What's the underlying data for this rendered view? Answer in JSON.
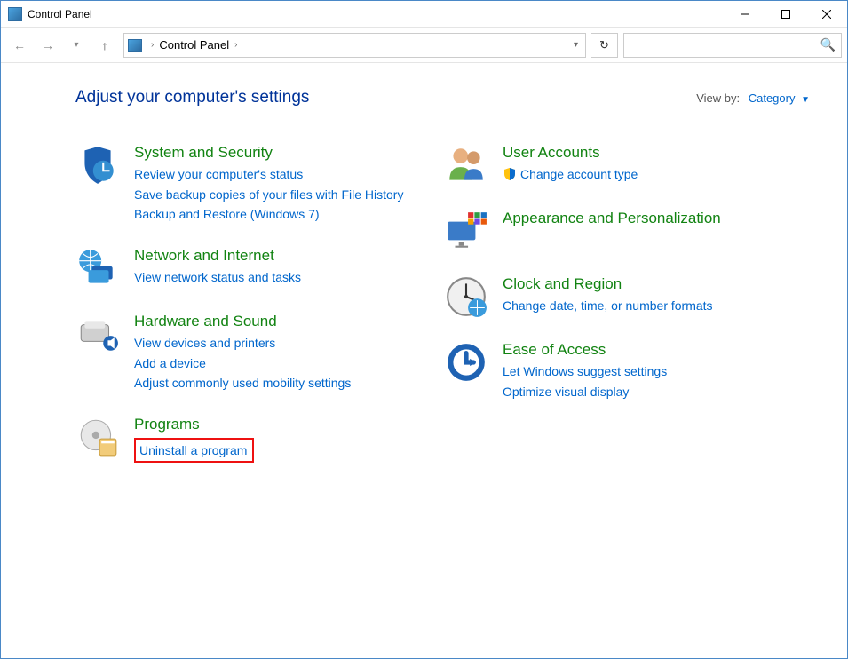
{
  "window": {
    "title": "Control Panel"
  },
  "breadcrumb": {
    "root": "Control Panel"
  },
  "header": {
    "heading": "Adjust your computer's settings"
  },
  "viewby": {
    "label": "View by:",
    "value": "Category"
  },
  "search": {
    "placeholder": ""
  },
  "left": [
    {
      "title": "System and Security",
      "tasks": [
        "Review your computer's status",
        "Save backup copies of your files with File History",
        "Backup and Restore (Windows 7)"
      ]
    },
    {
      "title": "Network and Internet",
      "tasks": [
        "View network status and tasks"
      ]
    },
    {
      "title": "Hardware and Sound",
      "tasks": [
        "View devices and printers",
        "Add a device",
        "Adjust commonly used mobility settings"
      ]
    },
    {
      "title": "Programs",
      "tasks": [
        "Uninstall a program"
      ]
    }
  ],
  "right": [
    {
      "title": "User Accounts",
      "tasks": [
        "Change account type"
      ],
      "shield": true
    },
    {
      "title": "Appearance and Personalization",
      "tasks": []
    },
    {
      "title": "Clock and Region",
      "tasks": [
        "Change date, time, or number formats"
      ]
    },
    {
      "title": "Ease of Access",
      "tasks": [
        "Let Windows suggest settings",
        "Optimize visual display"
      ]
    }
  ]
}
